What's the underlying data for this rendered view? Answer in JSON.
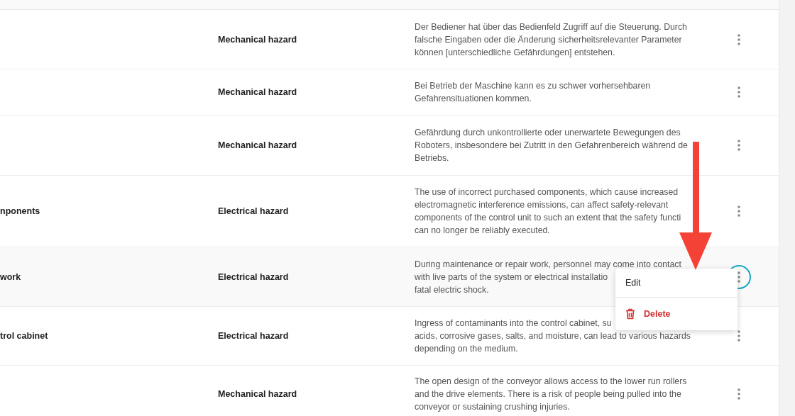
{
  "rows": [
    {
      "name": "",
      "category": "Mechanical hazard",
      "description": [
        "Der Bediener hat über das Bedienfeld Zugriff auf die Steuerung. Durch",
        "falsche Eingaben oder die Änderung sicherheitsrelevanter Parameter",
        "können [unterschiedliche Gefährdungen] entstehen."
      ],
      "selected": false
    },
    {
      "name": "",
      "category": "Mechanical hazard",
      "description": [
        "Bei Betrieb der Maschine kann es zu schwer vorhersehbaren",
        "Gefahrensituationen kommen."
      ],
      "selected": false
    },
    {
      "name": "",
      "category": "Mechanical hazard",
      "description": [
        "Gefährdung durch unkontrollierte oder unerwartete Bewegungen des",
        "Roboters, insbesondere bei Zutritt in den Gefahrenbereich während de",
        "Betriebs."
      ],
      "selected": false
    },
    {
      "name": "nponents",
      "category": "Electrical hazard",
      "description": [
        "The use of incorrect purchased components, which cause increased",
        "electromagnetic interference emissions, can affect safety-relevant",
        "components of the control unit to such an extent that the safety functi",
        "can no longer be reliably executed."
      ],
      "selected": false
    },
    {
      "name": "work",
      "category": "Electrical hazard",
      "description": [
        "During maintenance or repair work, personnel may come into contact",
        "with live parts of the system or electrical installatio",
        "fatal electric shock."
      ],
      "selected": true
    },
    {
      "name": "trol cabinet",
      "category": "Electrical hazard",
      "description": [
        "Ingress of contaminants into the control cabinet, su",
        "acids, corrosive gases, salts, and moisture, can lead to various hazards",
        "depending on the medium."
      ],
      "selected": false
    },
    {
      "name": "",
      "category": "Mechanical hazard",
      "description": [
        "The open design of the conveyor allows access to the lower run rollers",
        "and the drive elements. There is a risk of people being pulled into the",
        "conveyor or sustaining crushing injuries."
      ],
      "selected": false
    }
  ],
  "menu": {
    "items": [
      {
        "kind": "edit",
        "label": "Edit"
      },
      {
        "kind": "delete",
        "label": "Delete"
      }
    ]
  }
}
